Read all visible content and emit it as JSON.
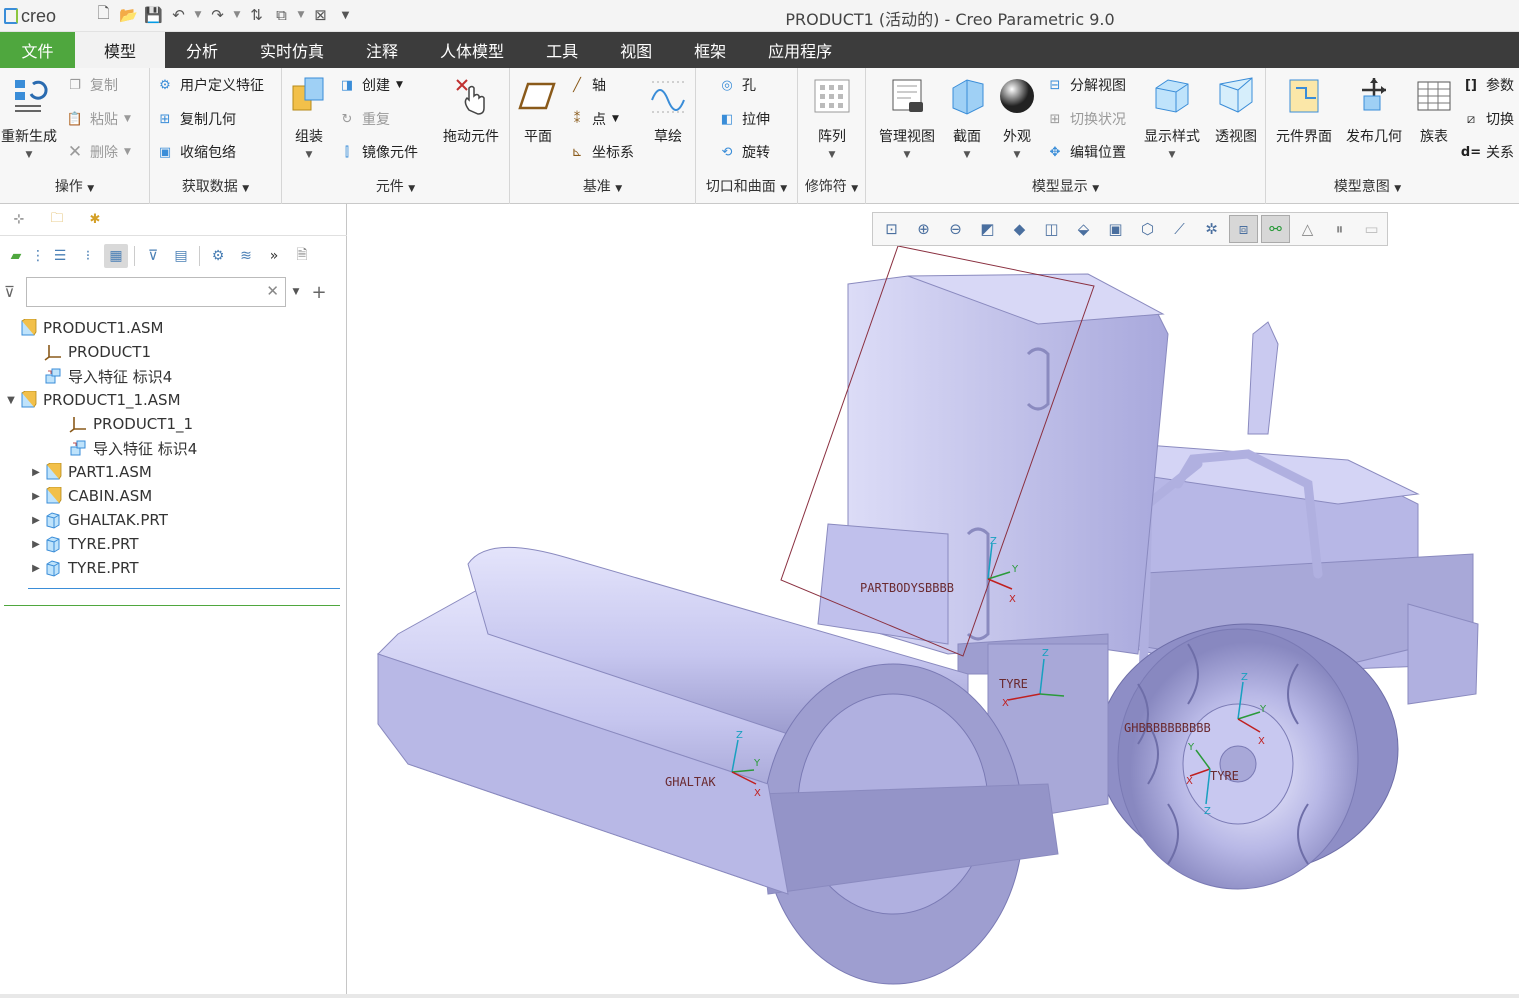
{
  "app": {
    "logo": "creo",
    "window_title": "PRODUCT1 (活动的) - Creo Parametric 9.0"
  },
  "menu": {
    "tabs": [
      "文件",
      "模型",
      "分析",
      "实时仿真",
      "注释",
      "人体模型",
      "工具",
      "视图",
      "框架",
      "应用程序"
    ],
    "active_tab": "模型"
  },
  "ribbon": {
    "operations": {
      "label": "操作",
      "regenerate": "重新生成",
      "copy": "复制",
      "paste": "粘贴",
      "delete": "删除"
    },
    "get_data": {
      "label": "获取数据",
      "udf": "用户定义特征",
      "copy_geometry": "复制几何",
      "shrinkwrap": "收缩包络"
    },
    "component": {
      "label": "元件",
      "assemble": "组装",
      "create": "创建",
      "repeat": "重复",
      "mirror": "镜像元件",
      "drag": "拖动元件"
    },
    "datum": {
      "label": "基准",
      "plane": "平面",
      "axis": "轴",
      "point": "点",
      "csys": "坐标系",
      "sketch": "草绘"
    },
    "cut_surface": {
      "label": "切口和曲面",
      "hole": "孔",
      "extrude": "拉伸",
      "revolve": "旋转"
    },
    "modifiers": {
      "label": "修饰符",
      "pattern": "阵列"
    },
    "model_display": {
      "label": "模型显示",
      "manage_views": "管理视图",
      "section": "截面",
      "appearance": "外观",
      "explode": "分解视图",
      "toggle_status": "切换状况",
      "edit_position": "编辑位置",
      "display_style": "显示样式",
      "perspective": "透视图"
    },
    "model_intent": {
      "label": "模型意图",
      "component_interface": "元件界面",
      "publish_geometry": "发布几何",
      "family_table": "族表",
      "parameters": "参数",
      "switch": "切换",
      "relations": "关系"
    }
  },
  "model_tree": {
    "search_placeholder": "",
    "nodes": [
      {
        "label": "PRODUCT1.ASM",
        "icon": "assembly-icon",
        "level": 0,
        "toggle": ""
      },
      {
        "label": "PRODUCT1",
        "icon": "csys-icon",
        "level": 1,
        "toggle": ""
      },
      {
        "label": "导入特征 标识4",
        "icon": "import-feature-icon",
        "level": 1,
        "toggle": ""
      },
      {
        "label": "PRODUCT1_1.ASM",
        "icon": "assembly-icon",
        "level": 0,
        "toggle": "▼"
      },
      {
        "label": "PRODUCT1_1",
        "icon": "csys-icon",
        "level": 2,
        "toggle": ""
      },
      {
        "label": "导入特征 标识4",
        "icon": "import-feature-icon",
        "level": 2,
        "toggle": ""
      },
      {
        "label": "PART1.ASM",
        "icon": "assembly-icon",
        "level": 1,
        "toggle": "▶"
      },
      {
        "label": "CABIN.ASM",
        "icon": "assembly-icon",
        "level": 1,
        "toggle": "▶"
      },
      {
        "label": "GHALTAK.PRT",
        "icon": "part-icon",
        "level": 1,
        "toggle": "▶"
      },
      {
        "label": "TYRE.PRT",
        "icon": "part-icon",
        "level": 1,
        "toggle": "▶"
      },
      {
        "label": "TYRE.PRT",
        "icon": "part-icon",
        "level": 1,
        "toggle": "▶"
      }
    ]
  },
  "viewport": {
    "labels": {
      "partbody": "PARTBODYSBBBB",
      "tyre1": "TYRE",
      "ghaltak": "GHALTAK",
      "ghbody": "GHBBBBBBBBBB",
      "tyre2": "TYRE"
    },
    "axes": {
      "x": "X",
      "y": "Y",
      "z": "Z"
    },
    "model_color": "#b4b4e6"
  }
}
